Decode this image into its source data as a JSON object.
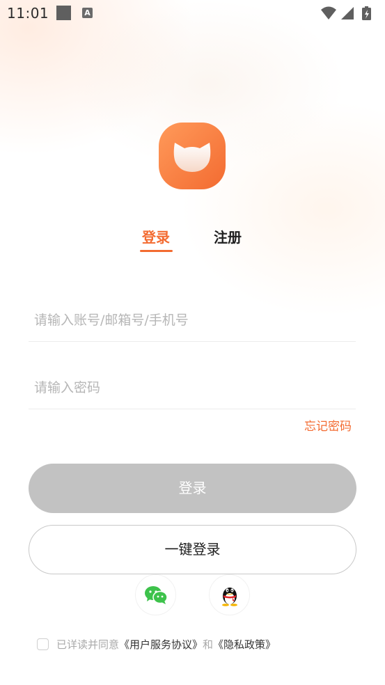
{
  "status_bar": {
    "time": "11:01",
    "notification_icons": [
      "gallery-icon",
      "keyboard-a-icon"
    ],
    "system_icons": [
      "wifi-icon",
      "signal-icon",
      "battery-charging-icon"
    ]
  },
  "logo": {
    "icon": "cat-logo-icon",
    "colors": {
      "primary": "#f36b31",
      "secondary": "#ff9a5a",
      "face": "#fdebe2"
    }
  },
  "tabs": [
    {
      "label": "登录",
      "active": true
    },
    {
      "label": "注册",
      "active": false
    }
  ],
  "form": {
    "account_placeholder": "请输入账号/邮箱号/手机号",
    "account_value": "",
    "password_placeholder": "请输入密码",
    "password_value": "",
    "forgot_label": "忘记密码"
  },
  "buttons": {
    "login_label": "登录",
    "onekey_label": "一键登录"
  },
  "social": [
    {
      "icon": "wechat-icon"
    },
    {
      "icon": "qq-icon"
    }
  ],
  "agreement": {
    "checked": false,
    "prefix": "已详读并同意",
    "service_link": "《用户服务协议》",
    "and": "和",
    "privacy_link": "《隐私政策》"
  },
  "colors": {
    "accent": "#f36b31",
    "disabled_button": "#c2c2c2",
    "placeholder": "#b6b6b6"
  }
}
